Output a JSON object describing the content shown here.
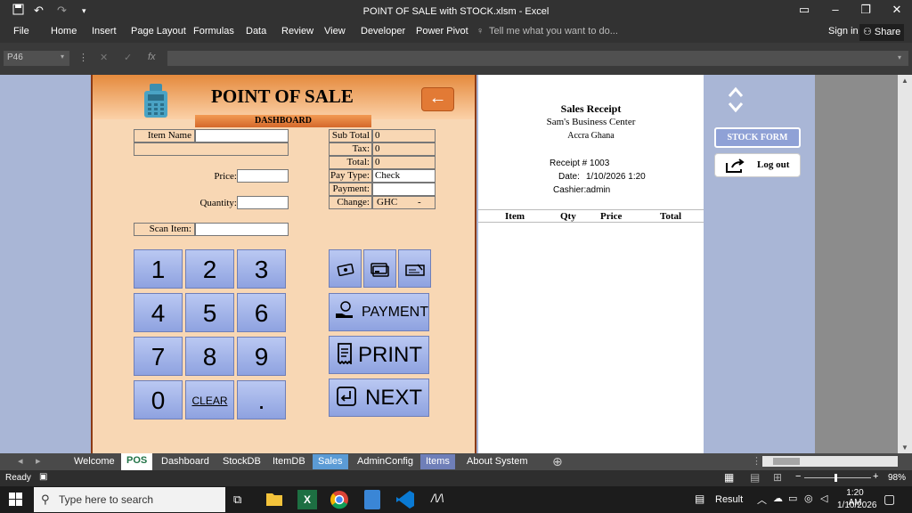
{
  "window": {
    "title": "POINT OF SALE with STOCK.xlsm - Excel",
    "min": "–",
    "restore": "❐",
    "close": "✕"
  },
  "ribbon": {
    "tabs": [
      "File",
      "Home",
      "Insert",
      "Page Layout",
      "Formulas",
      "Data",
      "Review",
      "View",
      "Developer",
      "Power Pivot"
    ],
    "tell_me": "Tell me what you want to do...",
    "signin": "Sign in",
    "share": "Share"
  },
  "formula_bar": {
    "namebox": "P46",
    "fx": "fx",
    "value": ""
  },
  "pos": {
    "title": "POINT OF SALE",
    "dashboard": "DASHBOARD",
    "back_arrow": "←",
    "item_name_label": "Item Name",
    "item_name_value": "",
    "price_label": "Price:",
    "price_value": "",
    "quantity_label": "Quantity:",
    "quantity_value": "",
    "scan_label": "Scan Item:",
    "scan_value": "",
    "totals": {
      "subtotal_label": "Sub Total",
      "subtotal_value": "0",
      "tax_label": "Tax:",
      "tax_value": "0",
      "total_label": "Total:",
      "total_value": "0",
      "paytype_label": "Pay Type:",
      "paytype_value": "Check",
      "payment_label": "Payment:",
      "payment_value": "",
      "change_label": "Change:",
      "change_currency": "GHC",
      "change_value": "-"
    },
    "keypad": [
      "1",
      "2",
      "3",
      "4",
      "5",
      "6",
      "7",
      "8",
      "9",
      "0",
      "CLEAR",
      "."
    ],
    "payment_button": "PAYMENT",
    "print_button": "PRINT",
    "next_button": "NEXT"
  },
  "receipt": {
    "title": "Sales Receipt",
    "business": "Sam's Business Center",
    "location": "Accra Ghana",
    "receipt_no": "Receipt # 1003",
    "date_label": "Date:",
    "date_value": "1/10/2026 1:20",
    "cashier_label": "Cashier:",
    "cashier_value": "admin",
    "columns": [
      "Item",
      "Qty",
      "Price",
      "Total"
    ]
  },
  "side": {
    "stock_form": "STOCK FORM",
    "logout": "Log out"
  },
  "sheet_tabs": [
    "Welcome",
    "POS",
    "Dashboard",
    "StockDB",
    "ItemDB",
    "Sales",
    "AdminConfig",
    "Items",
    "About System"
  ],
  "status": {
    "ready": "Ready",
    "zoom": "98%"
  },
  "taskbar": {
    "search_placeholder": "Type here to search",
    "result": "Result",
    "time": "1:20 AM",
    "date": "1/10/2026"
  },
  "colors": {
    "pos_bg": "#f8d7b4",
    "keypad": "#a4b6ec",
    "accent": "#e27a35",
    "sheet_bg": "#a9b6d6"
  }
}
